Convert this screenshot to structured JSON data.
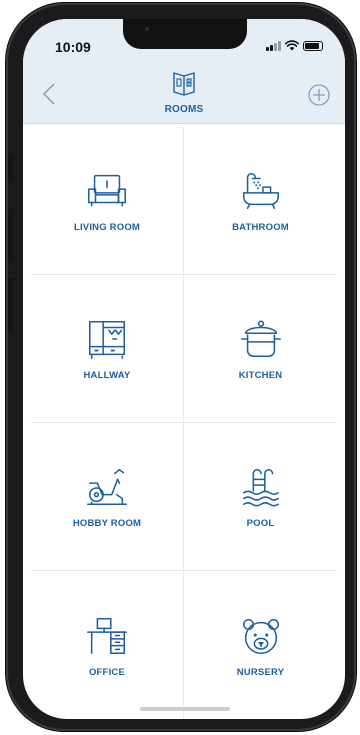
{
  "status_bar": {
    "time": "10:09"
  },
  "header": {
    "title": "ROOMS"
  },
  "colors": {
    "accent": "#1f5fa0",
    "header_bg": "#e6eef5",
    "divider": "#e4e8ec"
  },
  "rooms": [
    {
      "label": "LIVING ROOM",
      "icon": "armchair-icon"
    },
    {
      "label": "BATHROOM",
      "icon": "bathtub-icon"
    },
    {
      "label": "HALLWAY",
      "icon": "wardrobe-icon"
    },
    {
      "label": "KITCHEN",
      "icon": "cooking-pot-icon"
    },
    {
      "label": "HOBBY ROOM",
      "icon": "exercise-bike-icon"
    },
    {
      "label": "POOL",
      "icon": "pool-ladder-icon"
    },
    {
      "label": "OFFICE",
      "icon": "desk-icon"
    },
    {
      "label": "NURSERY",
      "icon": "teddy-bear-icon"
    }
  ]
}
